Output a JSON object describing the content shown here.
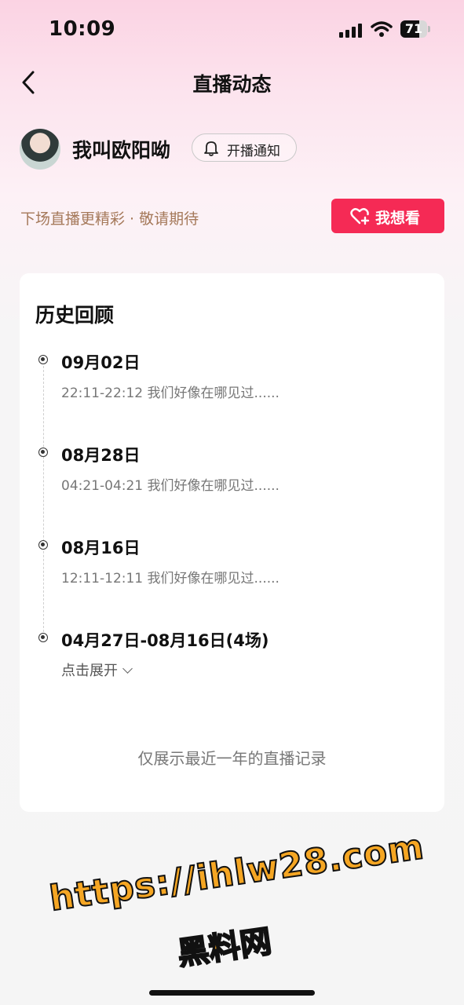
{
  "status_bar": {
    "time": "10:09",
    "battery": "71",
    "battery_level": 0.71
  },
  "header": {
    "title": "直播动态"
  },
  "profile": {
    "name": "我叫欧阳呦",
    "notify_label": "开播通知"
  },
  "promo": {
    "hint": "下场直播更精彩 · 敬请期待",
    "want_label": "我想看",
    "accent_color": "#f52a55"
  },
  "history": {
    "title": "历史回顾",
    "items": [
      {
        "date": "09月02日",
        "detail": "22:11-22:12 我们好像在哪见过......"
      },
      {
        "date": "08月28日",
        "detail": "04:21-04:21 我们好像在哪见过......"
      },
      {
        "date": "08月16日",
        "detail": "12:11-12:11 我们好像在哪见过......"
      },
      {
        "date": "04月27日-08月16日(4场)",
        "detail": "点击展开"
      }
    ],
    "footer": "仅展示最近一年的直播记录"
  },
  "watermark": {
    "line1": "https://ihlw28.com",
    "line2": "黑料网"
  },
  "icons": {
    "back": "back-chevron-icon",
    "bell": "bell-icon",
    "heart": "heart-plus-icon",
    "expand": "chevron-down-icon"
  }
}
